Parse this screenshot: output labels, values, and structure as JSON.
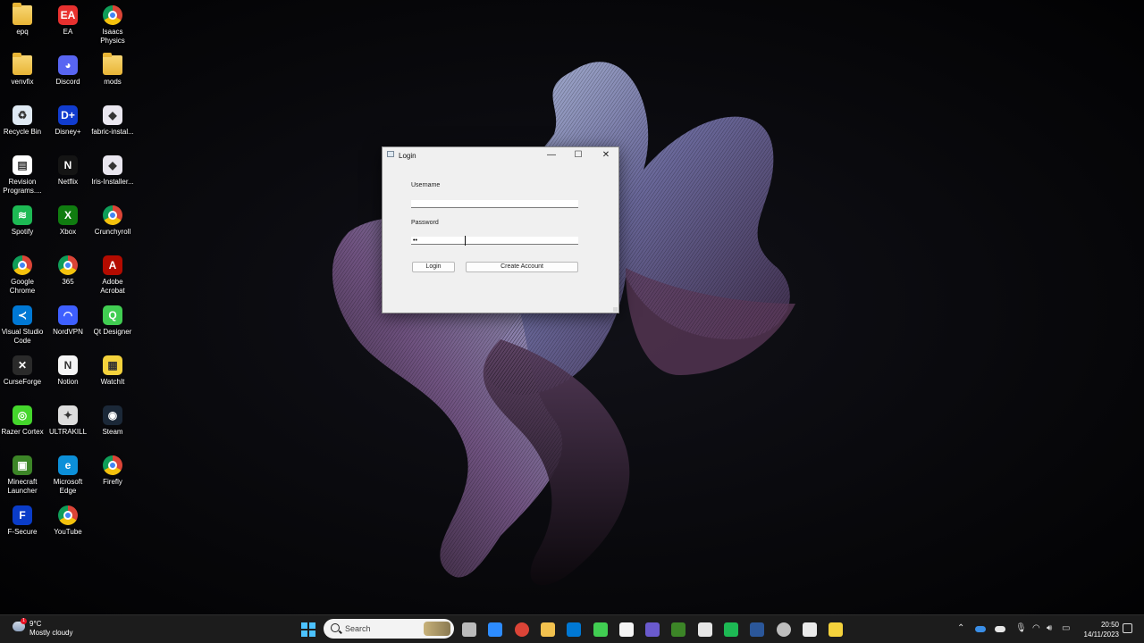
{
  "desktop": {
    "icons": [
      {
        "label": "epq",
        "type": "folder"
      },
      {
        "label": "EA",
        "type": "letter",
        "color": "#e8312f",
        "glyph": "EA"
      },
      {
        "label": "Isaacs Physics",
        "type": "chrome"
      },
      {
        "label": "venvfix",
        "type": "folder"
      },
      {
        "label": "Discord",
        "type": "letter",
        "color": "#5865f2",
        "glyph": "◕"
      },
      {
        "label": "mods",
        "type": "folder"
      },
      {
        "label": "Recycle Bin",
        "type": "letter",
        "color": "#dfe9f3",
        "glyph": "♻"
      },
      {
        "label": "Disney+",
        "type": "letter",
        "color": "#113ccf",
        "glyph": "D+"
      },
      {
        "label": "fabric-instal...",
        "type": "letter",
        "color": "#e9e6ef",
        "glyph": "◆"
      },
      {
        "label": "Revision Programs....",
        "type": "letter",
        "color": "#ffffff",
        "glyph": "▤"
      },
      {
        "label": "Netflix",
        "type": "letter",
        "color": "#141414",
        "glyph": "N"
      },
      {
        "label": "Iris-Installer...",
        "type": "letter",
        "color": "#e9e6ef",
        "glyph": "◆"
      },
      {
        "label": "Spotify",
        "type": "letter",
        "color": "#1db954",
        "glyph": "≋"
      },
      {
        "label": "Xbox",
        "type": "letter",
        "color": "#107c10",
        "glyph": "X"
      },
      {
        "label": "Crunchyroll",
        "type": "chrome"
      },
      {
        "label": "Google Chrome",
        "type": "chrome"
      },
      {
        "label": "365",
        "type": "chrome"
      },
      {
        "label": "Adobe Acrobat",
        "type": "letter",
        "color": "#b30b00",
        "glyph": "A"
      },
      {
        "label": "Visual Studio Code",
        "type": "letter",
        "color": "#0078d4",
        "glyph": "≺"
      },
      {
        "label": "NordVPN",
        "type": "letter",
        "color": "#3e5fff",
        "glyph": "◠"
      },
      {
        "label": "Qt Designer",
        "type": "letter",
        "color": "#41cd52",
        "glyph": "Q"
      },
      {
        "label": "CurseForge",
        "type": "letter",
        "color": "#2a2a2a",
        "glyph": "✕"
      },
      {
        "label": "Notion",
        "type": "letter",
        "color": "#f5f5f5",
        "glyph": "N"
      },
      {
        "label": "WatchIt",
        "type": "letter",
        "color": "#f4d23c",
        "glyph": "▦"
      },
      {
        "label": "Razer Cortex",
        "type": "letter",
        "color": "#44d62c",
        "glyph": "◎"
      },
      {
        "label": "ULTRAKILL",
        "type": "letter",
        "color": "#dddddd",
        "glyph": "✦"
      },
      {
        "label": "Steam",
        "type": "letter",
        "color": "#1b2838",
        "glyph": "◉"
      },
      {
        "label": "Minecraft Launcher",
        "type": "letter",
        "color": "#3c8527",
        "glyph": "▣"
      },
      {
        "label": "Microsoft Edge",
        "type": "letter",
        "color": "#0c8fd8",
        "glyph": "e"
      },
      {
        "label": "Firefly",
        "type": "chrome"
      },
      {
        "label": "F-Secure",
        "type": "letter",
        "color": "#0a3cc8",
        "glyph": "F"
      },
      {
        "label": "YouTube",
        "type": "chrome"
      }
    ]
  },
  "login_window": {
    "title": "Login",
    "minimize": "—",
    "maximize": "☐",
    "close": "✕",
    "username_label": "Username",
    "username_value": "",
    "password_label": "Password",
    "password_value": "••",
    "login_button": "Login",
    "create_account_button": "Create Account"
  },
  "taskbar": {
    "weather_temp": "9°C",
    "weather_desc": "Mostly cloudy",
    "weather_badge": "1",
    "search_placeholder": "Search",
    "apps": [
      {
        "name": "task-view",
        "color": "#bbbbbb"
      },
      {
        "name": "zoom",
        "color": "#2d8cff"
      },
      {
        "name": "chrome",
        "color": "#db4437"
      },
      {
        "name": "file-explorer",
        "color": "#f2c14e"
      },
      {
        "name": "vscode",
        "color": "#0078d4"
      },
      {
        "name": "qt-designer",
        "color": "#41cd52"
      },
      {
        "name": "notion",
        "color": "#f5f5f5"
      },
      {
        "name": "obs",
        "color": "#6a5acd"
      },
      {
        "name": "minecraft",
        "color": "#3c8527"
      },
      {
        "name": "steam-dark",
        "color": "#e6e6e6"
      },
      {
        "name": "spotify",
        "color": "#1db954"
      },
      {
        "name": "word",
        "color": "#2b579a"
      },
      {
        "name": "chrome-canary",
        "color": "#bdbdbd"
      },
      {
        "name": "media-player",
        "color": "#eaeaea"
      },
      {
        "name": "notes",
        "color": "#f4d23c"
      }
    ],
    "time": "20:50",
    "date": "14/11/2023"
  },
  "colors": {
    "accent": "#4cc2ff",
    "taskbar": "#1c1c1c"
  }
}
